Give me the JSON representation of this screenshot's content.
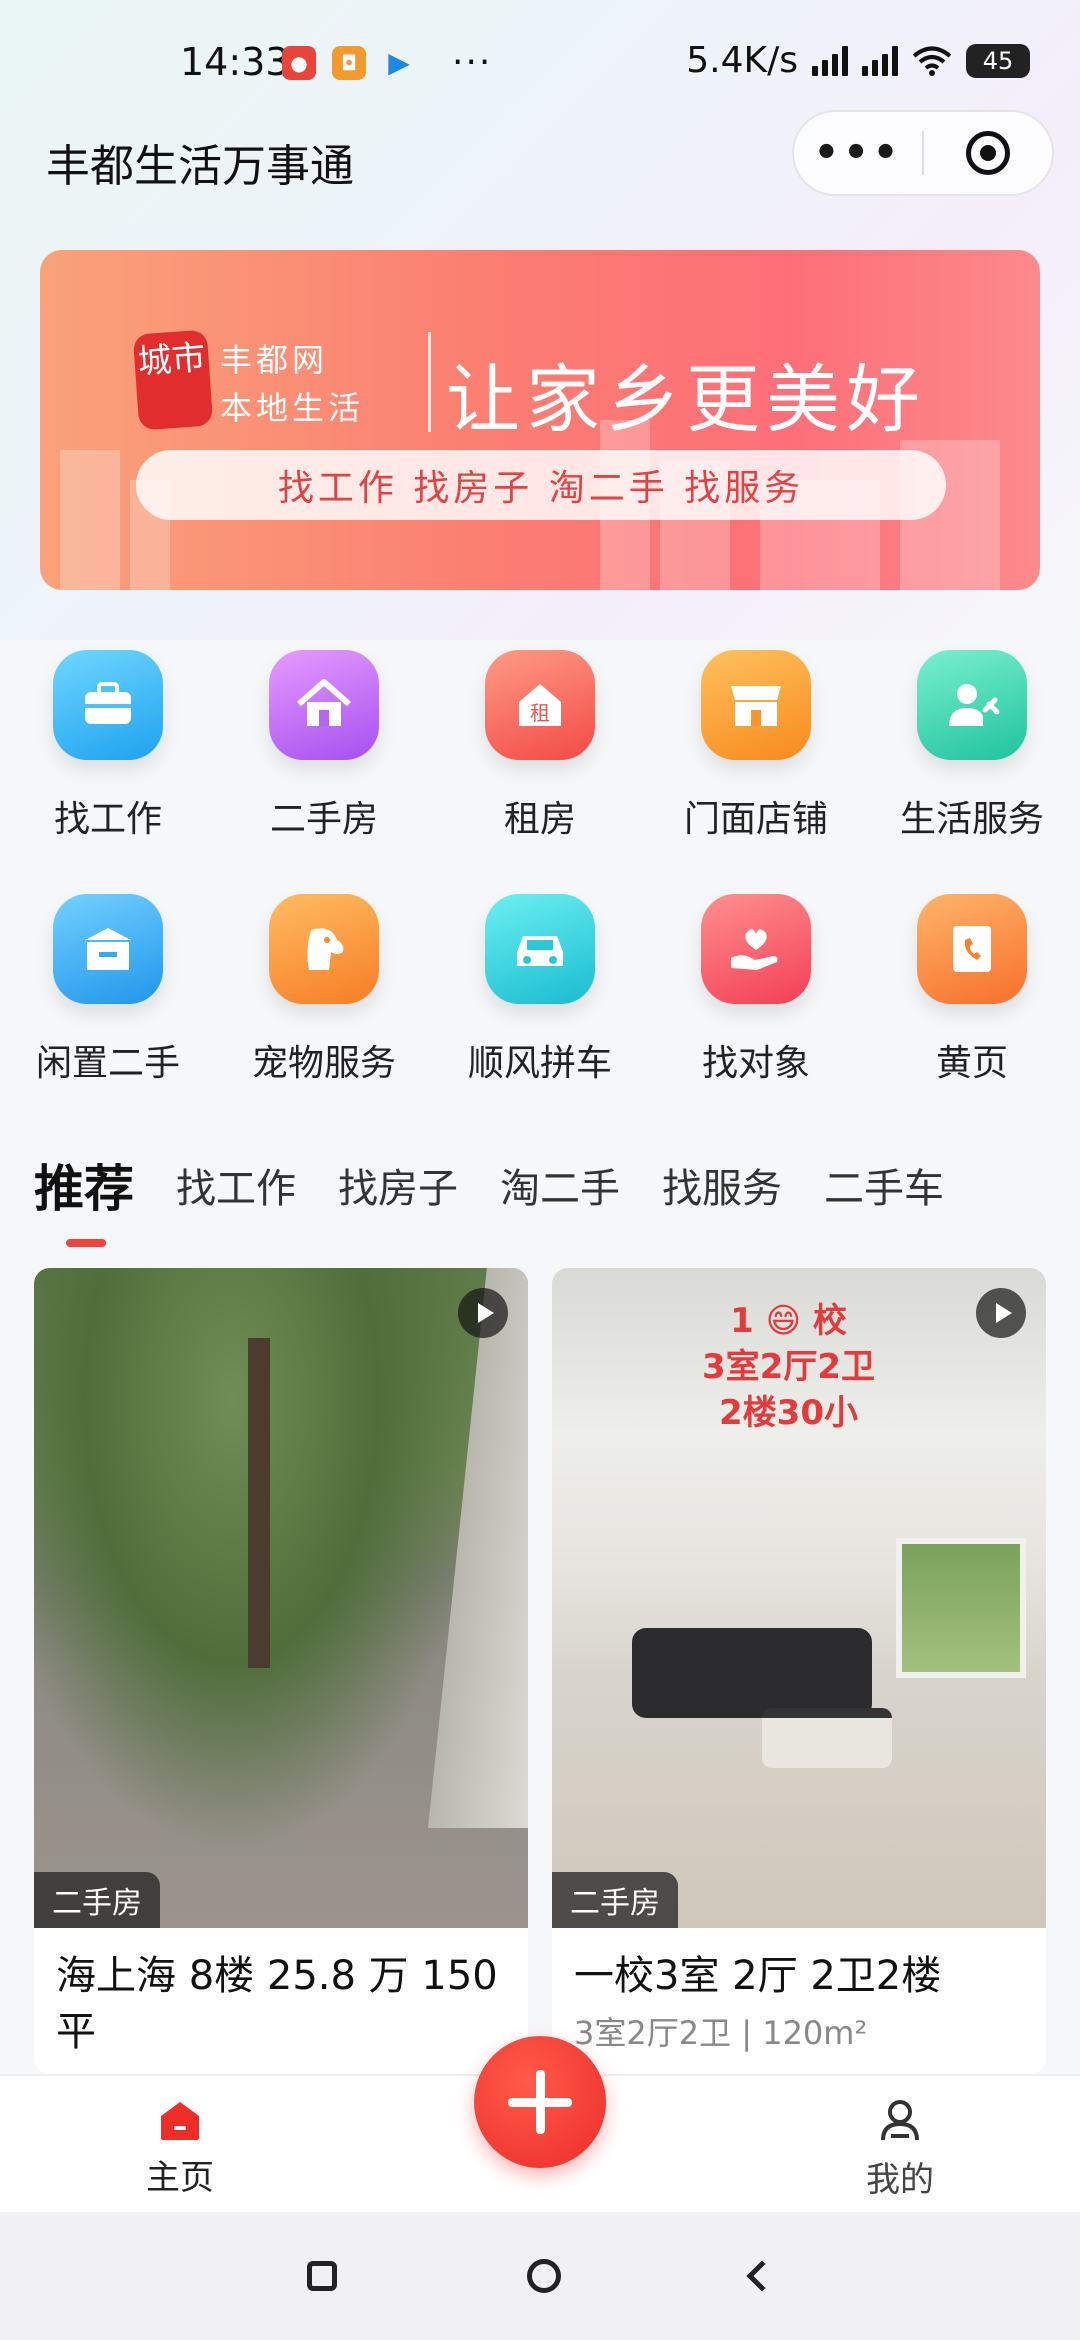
{
  "status_bar": {
    "time": "14:33",
    "dots": "···",
    "net_speed": "5.4K/s",
    "battery": "45"
  },
  "header": {
    "title": "丰都生活万事通",
    "more_label": "•••"
  },
  "banner": {
    "seal_text": "城市",
    "brand_line1": "丰都网",
    "brand_line2": "本地生活",
    "slogan": "让家乡更美好",
    "pill_text": "找工作  找房子  淘二手  找服务"
  },
  "categories": [
    {
      "label": "找工作",
      "icon": "briefcase-icon",
      "color": "#35b8f0"
    },
    {
      "label": "二手房",
      "icon": "house-icon",
      "color": "#c16ff0"
    },
    {
      "label": "租房",
      "icon": "rent-icon",
      "color": "#fb6a5c"
    },
    {
      "label": "门面店铺",
      "icon": "storefront-icon",
      "color": "#fca33d"
    },
    {
      "label": "生活服务",
      "icon": "service-worker-icon",
      "color": "#3fd6b0"
    },
    {
      "label": "闲置二手",
      "icon": "box-icon",
      "color": "#3fb6f2"
    },
    {
      "label": "宠物服务",
      "icon": "dog-icon",
      "color": "#fc963a"
    },
    {
      "label": "顺风拼车",
      "icon": "car-icon",
      "color": "#2fd0d8"
    },
    {
      "label": "找对象",
      "icon": "heart-hand-icon",
      "color": "#fb5b66"
    },
    {
      "label": "黄页",
      "icon": "phonebook-icon",
      "color": "#fc8c3a"
    }
  ],
  "tabs": [
    "推荐",
    "找工作",
    "找房子",
    "淘二手",
    "找服务",
    "二手车"
  ],
  "active_tab": "推荐",
  "feed": [
    {
      "tag": "二手房",
      "title": "海上海 8楼 25.8 万 150平",
      "subtitle": ""
    },
    {
      "tag": "二手房",
      "title": "一校3室 2厅 2卫2楼",
      "subtitle": "3室2厅2卫 | 120m²",
      "overlay": "1 😄 校\n3室2厅2卫\n2楼30小"
    }
  ],
  "bottom_nav": {
    "home_label": "主页",
    "me_label": "我的",
    "accent": "#ec2d28"
  }
}
